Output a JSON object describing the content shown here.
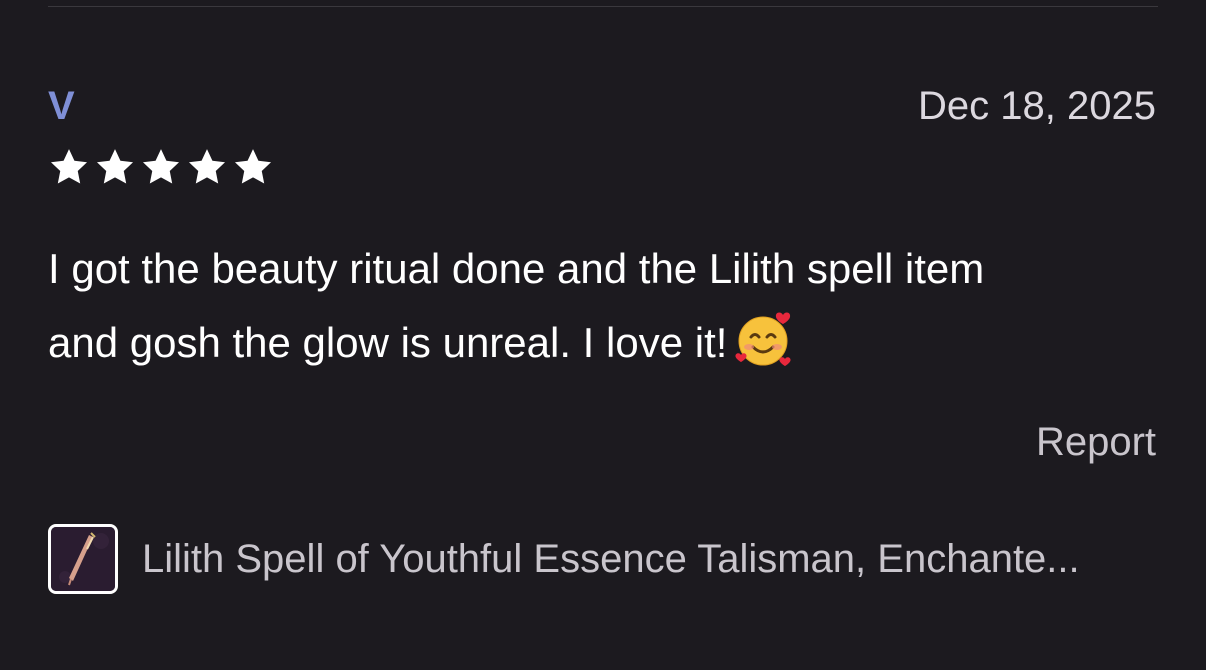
{
  "review": {
    "reviewer_initial": "V",
    "date": "Dec 18, 2025",
    "rating": 5,
    "max_rating": 5,
    "text_line1": "I got the beauty ritual done and the Lilith spell item",
    "text_line2": "and gosh the glow is unreal. I love it!",
    "emoji_icon": "smiling-face-with-hearts-icon"
  },
  "actions": {
    "report_label": "Report"
  },
  "product": {
    "title": "Lilith Spell of Youthful Essence Talisman, Enchante..."
  },
  "colors": {
    "background": "#1c1a1f",
    "reviewer_initial": "#7f8fd6",
    "star": "#ffffff",
    "primary_text": "#ffffff",
    "secondary_text": "#c9c5cc"
  }
}
